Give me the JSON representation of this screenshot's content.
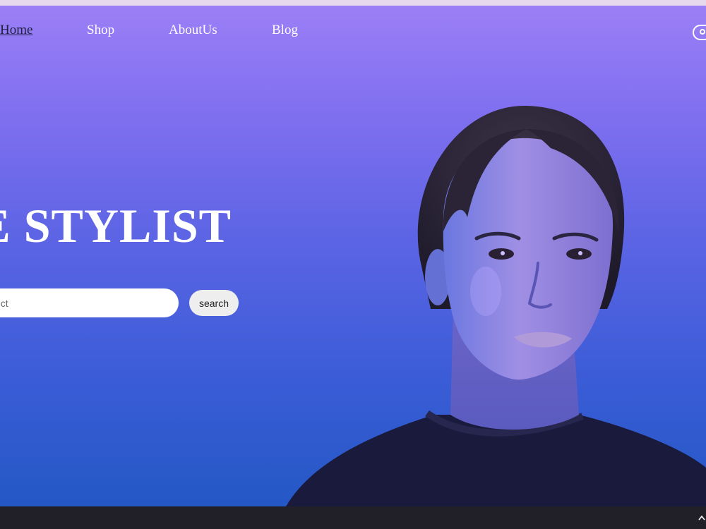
{
  "nav": {
    "items": [
      {
        "label": "Home",
        "active": true
      },
      {
        "label": "Shop",
        "active": false
      },
      {
        "label": "AboutUs",
        "active": false
      },
      {
        "label": "Blog",
        "active": false
      }
    ],
    "account_icon": "user-circle-icon"
  },
  "hero": {
    "title": "E STYLIST",
    "search": {
      "placeholder": "product",
      "button_label": "search"
    },
    "image": "woman-portrait"
  },
  "footer": {
    "scroll_icon": "chevron-up-icon"
  },
  "colors": {
    "hero_top": "#9b7ff6",
    "hero_bottom": "#2458c5",
    "footer": "#211f27",
    "active_nav": "#202040"
  }
}
